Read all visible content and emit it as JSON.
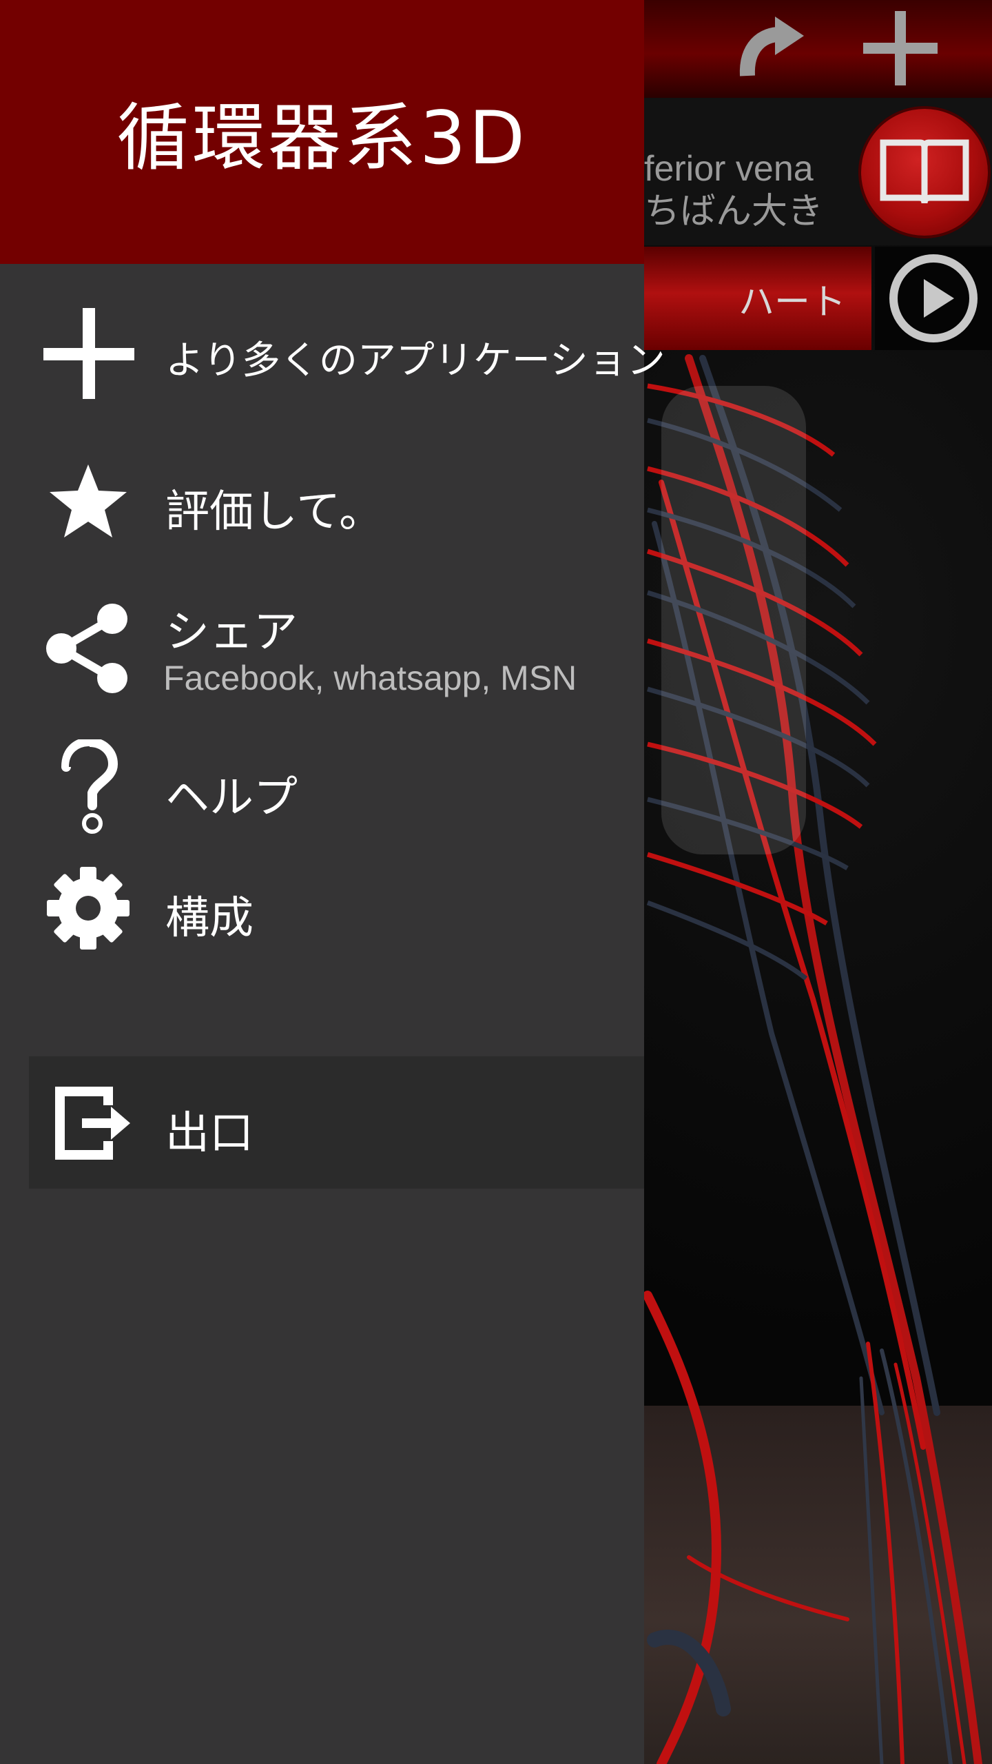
{
  "drawer": {
    "title": "循環器系3D",
    "items": [
      {
        "label": "より多くのアプリケーション",
        "icon": "plus-icon"
      },
      {
        "label": "評価して。",
        "icon": "star-icon"
      },
      {
        "label": "シェア",
        "sublabel": "Facebook, whatsapp, MSN",
        "icon": "share-icon"
      },
      {
        "label": "ヘルプ",
        "icon": "question-mark-icon"
      },
      {
        "label": "構成",
        "icon": "gear-icon"
      }
    ],
    "exit": {
      "label": "出口",
      "icon": "exit-icon"
    }
  },
  "viewer": {
    "info_line1": "ferior vena",
    "info_line2": "ちばん大き",
    "heart_button": "ハート",
    "top_icons": [
      "redo-icon",
      "plus-icon"
    ],
    "book_icon": "book-icon",
    "play_icon": "play-icon"
  },
  "colors": {
    "drawer_header": "#730000",
    "drawer_bg": "#353435",
    "exit_row_bg": "#2b2b2b",
    "accent_red": "#b01010"
  }
}
